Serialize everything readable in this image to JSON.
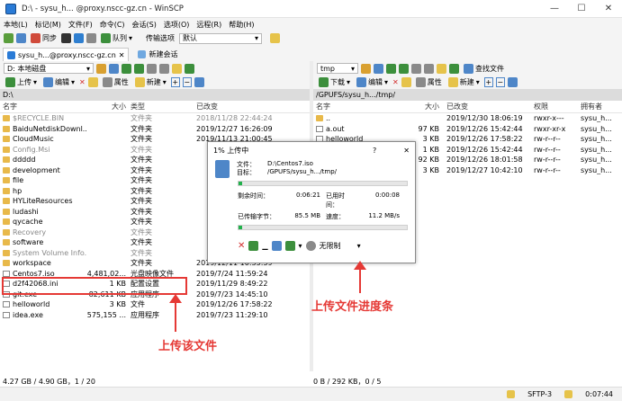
{
  "window": {
    "title": "D:\\ - sysu_h... @proxy.nscc-gz.cn - WinSCP"
  },
  "menu": [
    "本地(L)",
    "标记(M)",
    "文件(F)",
    "命令(C)",
    "会话(S)",
    "选项(O)",
    "远程(R)",
    "帮助(H)"
  ],
  "toolbar1": {
    "sync": "同步",
    "queue": "队列",
    "transfer_label": "传输选项",
    "transfer_value": "默认"
  },
  "tabs": {
    "session": "sysu_h...@proxy.nscc-gz.cn",
    "new_session": "新建会话"
  },
  "left": {
    "drive": "D: 本地磁盘",
    "path": "D:\\",
    "toolbar": {
      "upload": "上传",
      "edit": "编辑",
      "props": "属性",
      "new": "新建"
    },
    "columns": {
      "name": "名字",
      "size": "大小",
      "type": "类型",
      "modified": "已改变"
    },
    "files": [
      {
        "name": "$RECYCLE.BIN",
        "size": "",
        "type": "文件夹",
        "modified": "2018/11/28 22:44:24",
        "kind": "folder",
        "hidden": true
      },
      {
        "name": "BaiduNetdiskDownl...",
        "size": "",
        "type": "文件夹",
        "modified": "2019/12/27 16:26:09",
        "kind": "folder",
        "hidden": false
      },
      {
        "name": "CloudMusic",
        "size": "",
        "type": "文件夹",
        "modified": "2019/11/13 21:00:45",
        "kind": "folder",
        "hidden": false
      },
      {
        "name": "Config.Msi",
        "size": "",
        "type": "文件夹",
        "modified": "",
        "kind": "folder",
        "hidden": true
      },
      {
        "name": "ddddd",
        "size": "",
        "type": "文件夹",
        "modified": "",
        "kind": "folder",
        "hidden": false
      },
      {
        "name": "development",
        "size": "",
        "type": "文件夹",
        "modified": "",
        "kind": "folder",
        "hidden": false
      },
      {
        "name": "file",
        "size": "",
        "type": "文件夹",
        "modified": "",
        "kind": "folder",
        "hidden": false
      },
      {
        "name": "hp",
        "size": "",
        "type": "文件夹",
        "modified": "",
        "kind": "folder",
        "hidden": false
      },
      {
        "name": "HYLiteResources",
        "size": "",
        "type": "文件夹",
        "modified": "",
        "kind": "folder",
        "hidden": false
      },
      {
        "name": "ludashi",
        "size": "",
        "type": "文件夹",
        "modified": "",
        "kind": "folder",
        "hidden": false
      },
      {
        "name": "qycache",
        "size": "",
        "type": "文件夹",
        "modified": "",
        "kind": "folder",
        "hidden": false
      },
      {
        "name": "Recovery",
        "size": "",
        "type": "文件夹",
        "modified": "",
        "kind": "folder",
        "hidden": true
      },
      {
        "name": "software",
        "size": "",
        "type": "文件夹",
        "modified": "",
        "kind": "folder",
        "hidden": false
      },
      {
        "name": "System Volume Info...",
        "size": "",
        "type": "文件夹",
        "modified": "",
        "kind": "folder",
        "hidden": true
      },
      {
        "name": "workspace",
        "size": "",
        "type": "文件夹",
        "modified": "2019/12/11 10:35:39",
        "kind": "folder",
        "hidden": false
      },
      {
        "name": "Centos7.iso",
        "size": "4,481,02...",
        "type": "光盘映像文件",
        "modified": "2019/7/24 11:59:24",
        "kind": "file",
        "hidden": false
      },
      {
        "name": "d2f42068.ini",
        "size": "1 KB",
        "type": "配置设置",
        "modified": "2019/11/29 8:49:22",
        "kind": "file",
        "hidden": false
      },
      {
        "name": "git.exe",
        "size": "82,611 KB",
        "type": "应用程序",
        "modified": "2019/7/23 14:45:10",
        "kind": "file",
        "hidden": false
      },
      {
        "name": "helloworld",
        "size": "3 KB",
        "type": "文件",
        "modified": "2019/12/26 17:58:22",
        "kind": "file",
        "hidden": false
      },
      {
        "name": "idea.exe",
        "size": "575,155 ...",
        "type": "应用程序",
        "modified": "2019/7/23 11:29:10",
        "kind": "file",
        "hidden": false
      }
    ],
    "status": "4.27 GB / 4.90 GB，1 / 20"
  },
  "right": {
    "dir": "tmp",
    "find": "查找文件",
    "path": "/GPUFS/sysu_h.../tmp/",
    "toolbar": {
      "download": "下载",
      "edit": "编辑",
      "props": "属性",
      "new": "新建"
    },
    "columns": {
      "name": "名字",
      "size": "大小",
      "modified": "已改变",
      "perm": "权限",
      "owner": "拥有者"
    },
    "files": [
      {
        "name": "..",
        "size": "",
        "modified": "2019/12/30 18:06:19",
        "perm": "rwxr-x---",
        "owner": "sysu_h..."
      },
      {
        "name": "a.out",
        "size": "97 KB",
        "modified": "2019/12/26 15:42:44",
        "perm": "rwxr-xr-x",
        "owner": "sysu_h..."
      },
      {
        "name": "helloworld",
        "size": "3 KB",
        "modified": "2019/12/26 17:58:22",
        "perm": "rw-r--r--",
        "owner": "sysu_h..."
      },
      {
        "name": "",
        "size": "1 KB",
        "modified": "2019/12/26 15:42:44",
        "perm": "rw-r--r--",
        "owner": "sysu_h..."
      },
      {
        "name": "",
        "size": "92 KB",
        "modified": "2019/12/26 18:01:58",
        "perm": "rw-r--r--",
        "owner": "sysu_h..."
      },
      {
        "name": "",
        "size": "3 KB",
        "modified": "2019/12/27 10:42:10",
        "perm": "rw-r--r--",
        "owner": "sysu_h..."
      }
    ],
    "status": "0 B / 292 KB，0 / 5"
  },
  "bottom": {
    "protocol": "SFTP-3",
    "time": "0:07:44"
  },
  "dialog": {
    "title": "1% 上传中",
    "help": "?",
    "file_label": "文件：",
    "file_value": "D:\\Centos7.iso",
    "target_label": "目标：",
    "target_value": "/GPUFS/sysu_h.../tmp/",
    "remaining_label": "剩余时间：",
    "remaining_value": "0:06:21",
    "elapsed_label": "已用时间：",
    "elapsed_value": "0:00:08",
    "transferred_label": "已传输字节：",
    "transferred_value": "85.5 MB",
    "speed_label": "速度：",
    "speed_value": "11.2 MB/s",
    "progress_file": 0.02,
    "progress_total": 0.02,
    "limit": "无限制"
  },
  "annotations": {
    "upload_file": "上传该文件",
    "upload_progress": "上传文件进度条"
  },
  "colors": {
    "annotation": "#e53935",
    "progress": "#22b14c",
    "folder": "#e8b94a"
  }
}
